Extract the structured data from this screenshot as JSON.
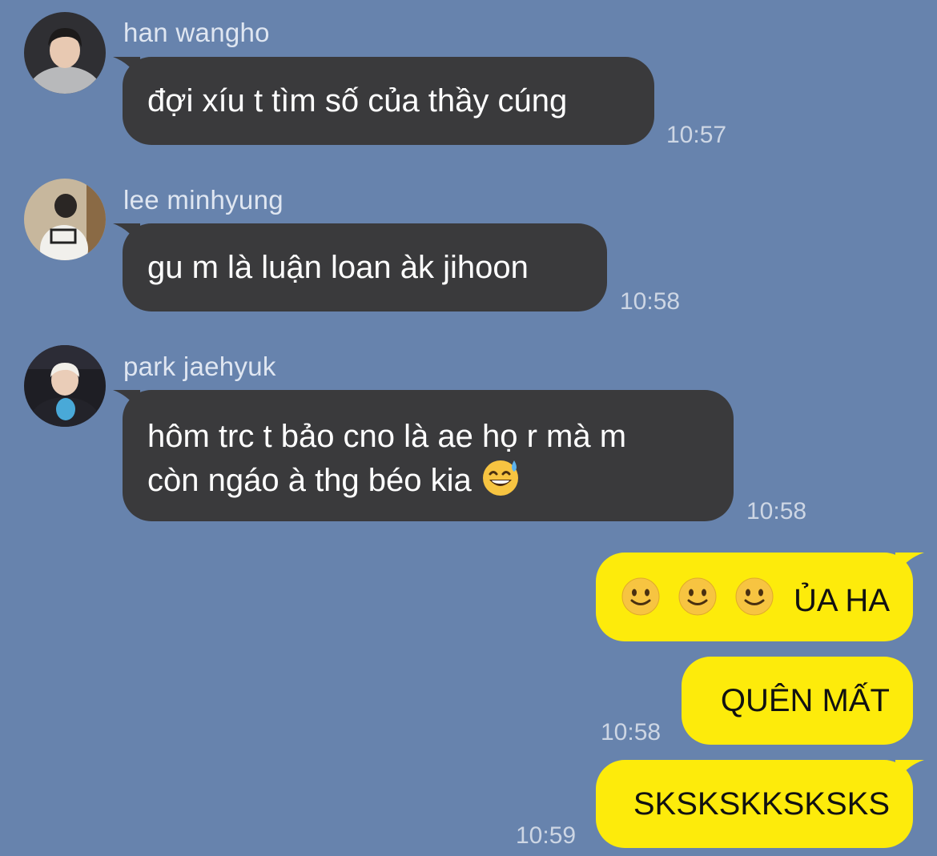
{
  "chat": {
    "messages": [
      {
        "sender": "han wangho",
        "text": "đợi xíu t tìm số của thầy cúng",
        "time": "10:57"
      },
      {
        "sender": "lee minhyung",
        "text": "gu m là luận loan àk jihoon",
        "time": "10:58"
      },
      {
        "sender": "park jaehyuk",
        "line1": "hôm trc t bảo cno là ae họ r mà m",
        "line2": "còn ngáo à thg béo kia",
        "emoji": "grinning-sweat-emoji",
        "time": "10:58"
      }
    ],
    "outgoing": [
      {
        "text": "ỦA HA",
        "emojis": [
          "slightly-smiling-emoji",
          "slightly-smiling-emoji",
          "slightly-smiling-emoji"
        ]
      },
      {
        "text": "QUÊN MẤT",
        "time": "10:58"
      },
      {
        "text": "SKSKSKKSKSKS",
        "time": "10:59"
      }
    ]
  },
  "colors": {
    "background": "#6783ad",
    "incoming_bubble": "#3a3a3c",
    "outgoing_bubble": "#fdeb0b"
  }
}
